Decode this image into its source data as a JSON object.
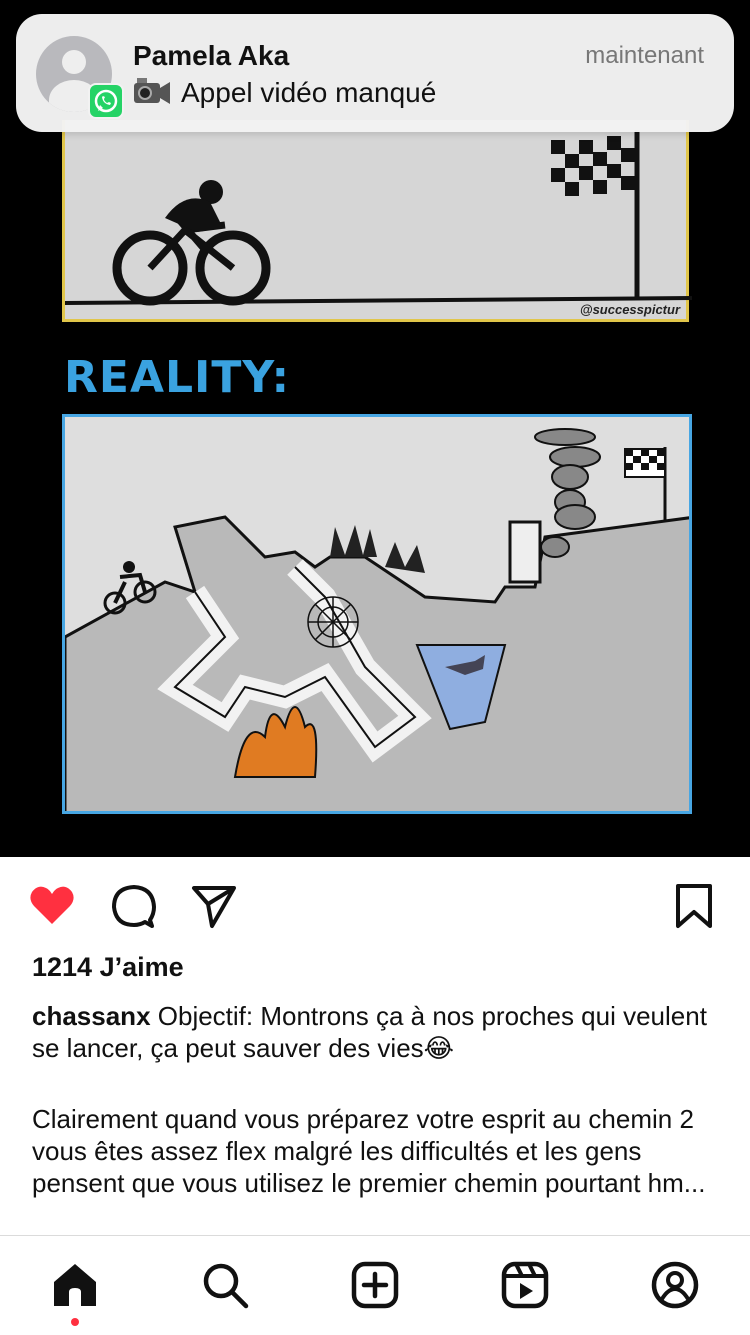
{
  "notification": {
    "app_icon": "whatsapp-icon",
    "sender": "Pamela Aka",
    "time": "maintenant",
    "message": "Appel vidéo manqué",
    "message_icon": "video-camera-icon"
  },
  "post_image": {
    "reality_label": "REALITY:",
    "watermark": "@successpictur"
  },
  "actions": {
    "like_icon": "heart-filled-icon",
    "comment_icon": "comment-icon",
    "share_icon": "send-icon",
    "save_icon": "bookmark-icon",
    "like_color": "#ff3040"
  },
  "post": {
    "likes": "1214 J’aime",
    "username": "chassanx",
    "caption_line1": " Objectif: Montrons ça à nos proches qui veulent se lancer, ça peut sauver des vies😂",
    "caption_line2": "Clairement quand vous préparez votre esprit au chemin 2 vous êtes assez flex malgré les difficultés et les gens pensent que vous utilisez le premier chemin pourtant hm..."
  },
  "tabbar": {
    "items": [
      "home-icon",
      "search-icon",
      "create-icon",
      "reels-icon",
      "profile-icon"
    ],
    "active": "home-icon"
  }
}
